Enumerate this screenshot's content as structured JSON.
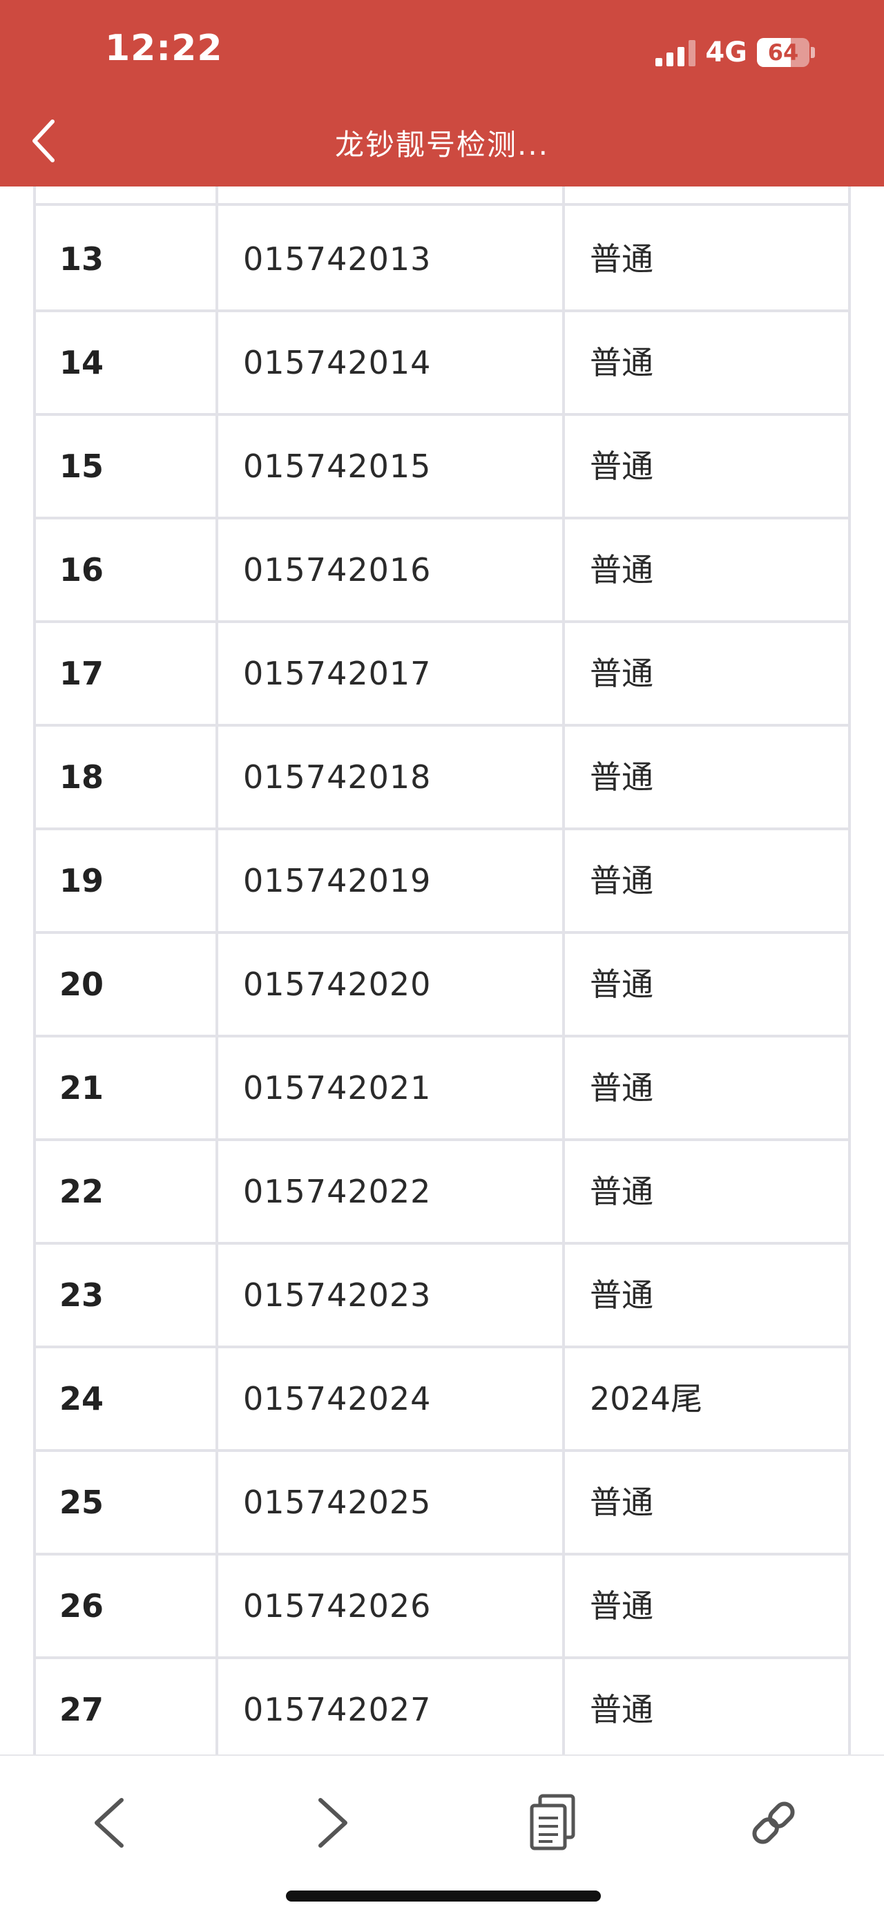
{
  "status_bar": {
    "time": "12:22",
    "network": "4G",
    "battery": "64",
    "battery_level": 0.64
  },
  "header": {
    "title": "龙钞靓号检测..."
  },
  "table": {
    "rows": [
      {
        "index": "13",
        "number": "015742013",
        "tag": "普通"
      },
      {
        "index": "14",
        "number": "015742014",
        "tag": "普通"
      },
      {
        "index": "15",
        "number": "015742015",
        "tag": "普通"
      },
      {
        "index": "16",
        "number": "015742016",
        "tag": "普通"
      },
      {
        "index": "17",
        "number": "015742017",
        "tag": "普通"
      },
      {
        "index": "18",
        "number": "015742018",
        "tag": "普通"
      },
      {
        "index": "19",
        "number": "015742019",
        "tag": "普通"
      },
      {
        "index": "20",
        "number": "015742020",
        "tag": "普通"
      },
      {
        "index": "21",
        "number": "015742021",
        "tag": "普通"
      },
      {
        "index": "22",
        "number": "015742022",
        "tag": "普通"
      },
      {
        "index": "23",
        "number": "015742023",
        "tag": "普通"
      },
      {
        "index": "24",
        "number": "015742024",
        "tag": "2024尾"
      },
      {
        "index": "25",
        "number": "015742025",
        "tag": "普通"
      },
      {
        "index": "26",
        "number": "015742026",
        "tag": "普通"
      },
      {
        "index": "27",
        "number": "015742027",
        "tag": "普通"
      }
    ]
  },
  "toolbar": {
    "icons": [
      "back-icon",
      "forward-icon",
      "pages-icon",
      "link-icon"
    ]
  }
}
